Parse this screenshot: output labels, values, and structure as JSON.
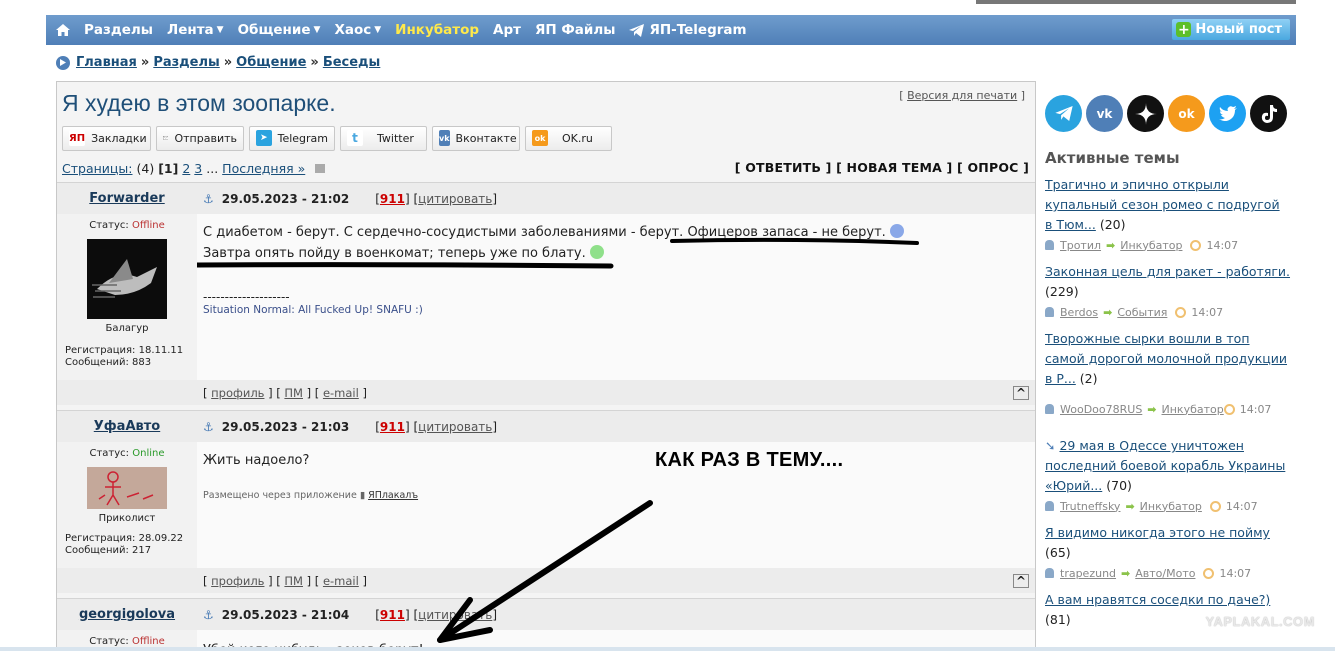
{
  "nav": {
    "items": [
      {
        "label": "Разделы",
        "caret": false,
        "highlight": false
      },
      {
        "label": "Лента",
        "caret": true,
        "highlight": false
      },
      {
        "label": "Общение",
        "caret": true,
        "highlight": false
      },
      {
        "label": "Хаос",
        "caret": true,
        "highlight": false
      },
      {
        "label": "Инкубатор",
        "caret": false,
        "highlight": true
      },
      {
        "label": "Арт",
        "caret": false,
        "highlight": false
      },
      {
        "label": "ЯП Файлы",
        "caret": false,
        "highlight": false
      },
      {
        "label": "ЯП-Telegram",
        "caret": false,
        "highlight": false
      }
    ],
    "new_post": "Новый пост"
  },
  "breadcrumb": [
    "Главная",
    "Разделы",
    "Общение",
    "Беседы"
  ],
  "breadcrumb_sep": "»",
  "topic": {
    "title": "Я худею в этом зоопарке.",
    "print_version": "Версия для печати"
  },
  "share": [
    "Закладки",
    "Отправить",
    "Telegram",
    "Twitter",
    "Вконтакте",
    "OK.ru"
  ],
  "share_icons": {
    "bookmarks": "ЯП",
    "ok": "ok"
  },
  "pages": {
    "label": "Страницы:",
    "count": "(4)",
    "current": "[1]",
    "p2": "2",
    "p3": "3",
    "dots": "...",
    "last": "Последняя »"
  },
  "actions": "[ ОТВЕТИТЬ ] [ НОВАЯ ТЕМА ] [ ОПРОС ]",
  "posts": [
    {
      "nick": "Forwarder",
      "date": "29.05.2023 - 21:02",
      "num": "911",
      "cite": "цитировать",
      "status_label": "Статус:",
      "status": "Offline",
      "rank": "Балагур",
      "reg": "Регистрация: 18.11.11",
      "msgs": "Сообщений: 883",
      "line1": "С диабетом - берут. С сердечно-сосудистыми заболеваниями - берут. Офицеров запаса - не берут.",
      "line2": "Завтра опять пойду в военкомат; теперь уже по блату.",
      "sig_line": "--------------------",
      "sig": "Situation Normal: All Fucked Up! SNAFU :)"
    },
    {
      "nick": "УфаАвто",
      "date": "29.05.2023 - 21:03",
      "num": "911",
      "cite": "цитировать",
      "status_label": "Статус:",
      "status": "Online",
      "rank": "Приколист",
      "reg": "Регистрация: 28.09.22",
      "msgs": "Сообщений: 217",
      "line1": "Жить надоело?",
      "app_prefix": "Размещено через приложение",
      "app_name": "ЯПлакалъ"
    },
    {
      "nick": "georgigolova",
      "date": "29.05.2023 - 21:04",
      "num": "911",
      "cite": "цитировать",
      "status_label": "Статус:",
      "status": "Offline",
      "line1": "Убей кого нибудь - зеков берут!"
    }
  ],
  "foot": {
    "profile": "профиль",
    "pm": "ПМ",
    "email": "e-mail",
    "up": "^"
  },
  "overlay_text": "КАК РАЗ В ТЕМУ....",
  "sidebar": {
    "social": [
      "telegram-icon",
      "vk-icon",
      "zen-icon",
      "odnoklassniki-icon",
      "twitter-icon",
      "tiktok-icon"
    ],
    "active_title": "Активные темы",
    "topics": [
      {
        "title": "Трагично и эпично открыли купальный сезон ромео с подругой в Тюм...",
        "count": "(20)",
        "user": "Тротил",
        "section": "Инкубатор",
        "time": "14:07"
      },
      {
        "title": "Законная цель для ракет - работяги.",
        "count": "(229)",
        "user": "Berdos",
        "section": "События",
        "time": "14:07"
      },
      {
        "title": "Творожные сырки вошли в топ самой дорогой молочной продукции в Р...",
        "count": "(2)",
        "user": "WooDoo78RUS",
        "section": "Инкубатор",
        "time": "14:07"
      },
      {
        "title": "29 мая в Одессе уничтожен последний боевой корабль Украины «Юрий...",
        "count": "(70)",
        "user": "Trutneffsky",
        "section": "Инкубатор",
        "time": "14:07"
      },
      {
        "title": "Я видимо никогда этого не пойму",
        "count": "(65)",
        "user": "trapezund",
        "section": "Авто/Мото",
        "time": "14:07"
      },
      {
        "title": "А вам нравятся соседки по даче?)",
        "count": "(81)"
      }
    ]
  },
  "watermark": "YAPLAKAL.COM",
  "colors": {
    "nav": "#5a88c0",
    "highlight": "#ffe94a",
    "link": "#1a4f7a",
    "offline": "#b33333",
    "online": "#2a9a2a",
    "post_num": "#cc0000"
  }
}
